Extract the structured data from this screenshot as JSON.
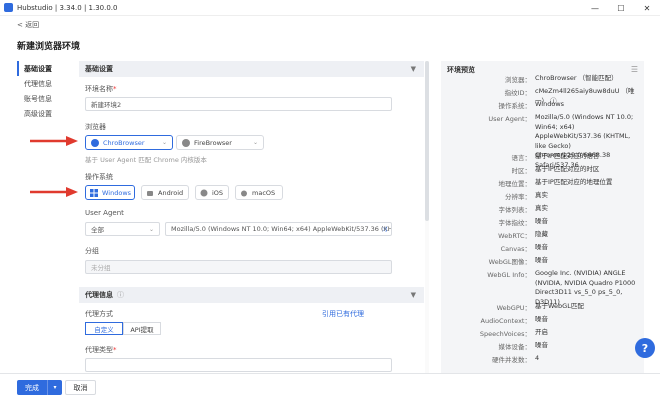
{
  "window": {
    "title": "Hubstudio | 3.34.0 | 1.30.0.0",
    "minimize": "—",
    "maximize": "☐",
    "close": "✕"
  },
  "back_label": "< 返回",
  "page_title": "新建浏览器环境",
  "nav": [
    "基础设置",
    "代理信息",
    "账号信息",
    "高级设置"
  ],
  "basic": {
    "section_title": "基础设置",
    "env_name_label": "环境名称",
    "env_name_value": "新建环境2",
    "browser_label": "浏览器",
    "browsers": [
      "ChroBrowser",
      "FireBrowser"
    ],
    "browser_hint": "基于 User Agent 匹配 Chrome 内核版本",
    "os_label": "操作系统",
    "os_options": [
      "Windows",
      "Android",
      "iOS",
      "macOS"
    ],
    "ua_label": "User Agent",
    "ua_select": "全部",
    "ua_value": "Mozilla/5.0 (Windows NT 10.0; Win64; x64) AppleWebKit/537.36 (KH",
    "group_label": "分组",
    "group_placeholder": "未分组"
  },
  "proxy": {
    "section_title": "代理信息",
    "method_label": "代理方式",
    "existing_link": "引用已有代理",
    "tabs": [
      "自定义",
      "API提取"
    ],
    "type_label": "代理类型"
  },
  "preview": {
    "title": "环境预览",
    "rows": [
      {
        "k": "浏览器：",
        "v": "ChroBrowser （智能匹配）"
      },
      {
        "k": "指纹ID：",
        "v": "cMeZm4ll265aiy8uw8duU （唯一） ⓘ"
      },
      {
        "k": "操作系统：",
        "v": "Windows"
      },
      {
        "k": "User Agent：",
        "v": "Mozilla/5.0 (Windows NT 10.0; Win64; x64) AppleWebKit/537.36 (KHTML, like Gecko) Chrome/129.0.6668.38 Safari/537.36"
      },
      {
        "k": "语言：",
        "v": "基于IP匹配对应的语言"
      },
      {
        "k": "时区：",
        "v": "基于IP匹配对应的时区"
      },
      {
        "k": "地理位置：",
        "v": "基于IP匹配对应的地理位置"
      },
      {
        "k": "分辨率：",
        "v": "真实"
      },
      {
        "k": "字体列表：",
        "v": "真实"
      },
      {
        "k": "字体指纹：",
        "v": "噪音"
      },
      {
        "k": "WebRTC：",
        "v": "隐藏"
      },
      {
        "k": "Canvas：",
        "v": "噪音"
      },
      {
        "k": "WebGL图像：",
        "v": "噪音"
      },
      {
        "k": "WebGL Info：",
        "v": "Google Inc. (NVIDIA) ANGLE (NVIDIA, NVIDIA Quadro P1000 Direct3D11 vs_5_0 ps_5_0, D3D11)"
      },
      {
        "k": "WebGPU：",
        "v": "基于WebGL匹配"
      },
      {
        "k": "AudioContext：",
        "v": "噪音"
      },
      {
        "k": "SpeechVoices：",
        "v": "开启"
      },
      {
        "k": "媒体设备：",
        "v": "噪音"
      },
      {
        "k": "硬件并发数：",
        "v": "4"
      }
    ]
  },
  "footer": {
    "primary": "完成",
    "cancel": "取消"
  },
  "help": "?",
  "colors": {
    "accent": "#2f6bde",
    "arrow": "#e03a2e"
  }
}
